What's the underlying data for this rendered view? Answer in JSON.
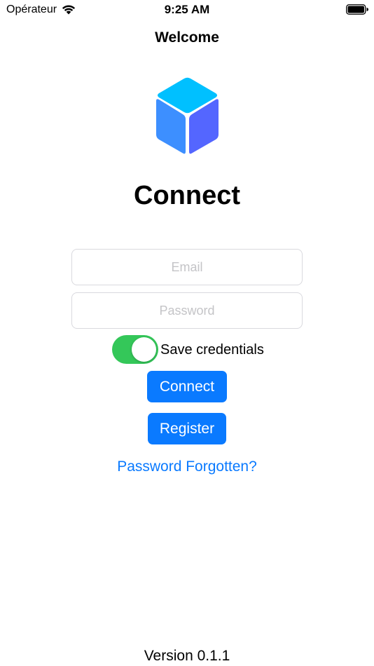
{
  "status_bar": {
    "carrier": "Opérateur",
    "time": "9:25 AM",
    "wifi_icon": "wifi-icon",
    "battery_icon": "battery-full-icon"
  },
  "nav": {
    "title": "Welcome"
  },
  "logo": {
    "icon": "cube-logo-icon",
    "colors": {
      "top": "#00c0ff",
      "left": "#3d8fff",
      "right": "#5466ff"
    }
  },
  "main": {
    "headline": "Connect",
    "email": {
      "value": "",
      "placeholder": "Email"
    },
    "password": {
      "value": "",
      "placeholder": "Password"
    },
    "save_credentials": {
      "label": "Save credentials",
      "on": true
    },
    "connect_label": "Connect",
    "register_label": "Register",
    "forgot_label": "Password Forgotten?"
  },
  "footer": {
    "version": "Version 0.1.1"
  },
  "colors": {
    "accent": "#0a7aff",
    "toggle_on": "#34c759"
  }
}
